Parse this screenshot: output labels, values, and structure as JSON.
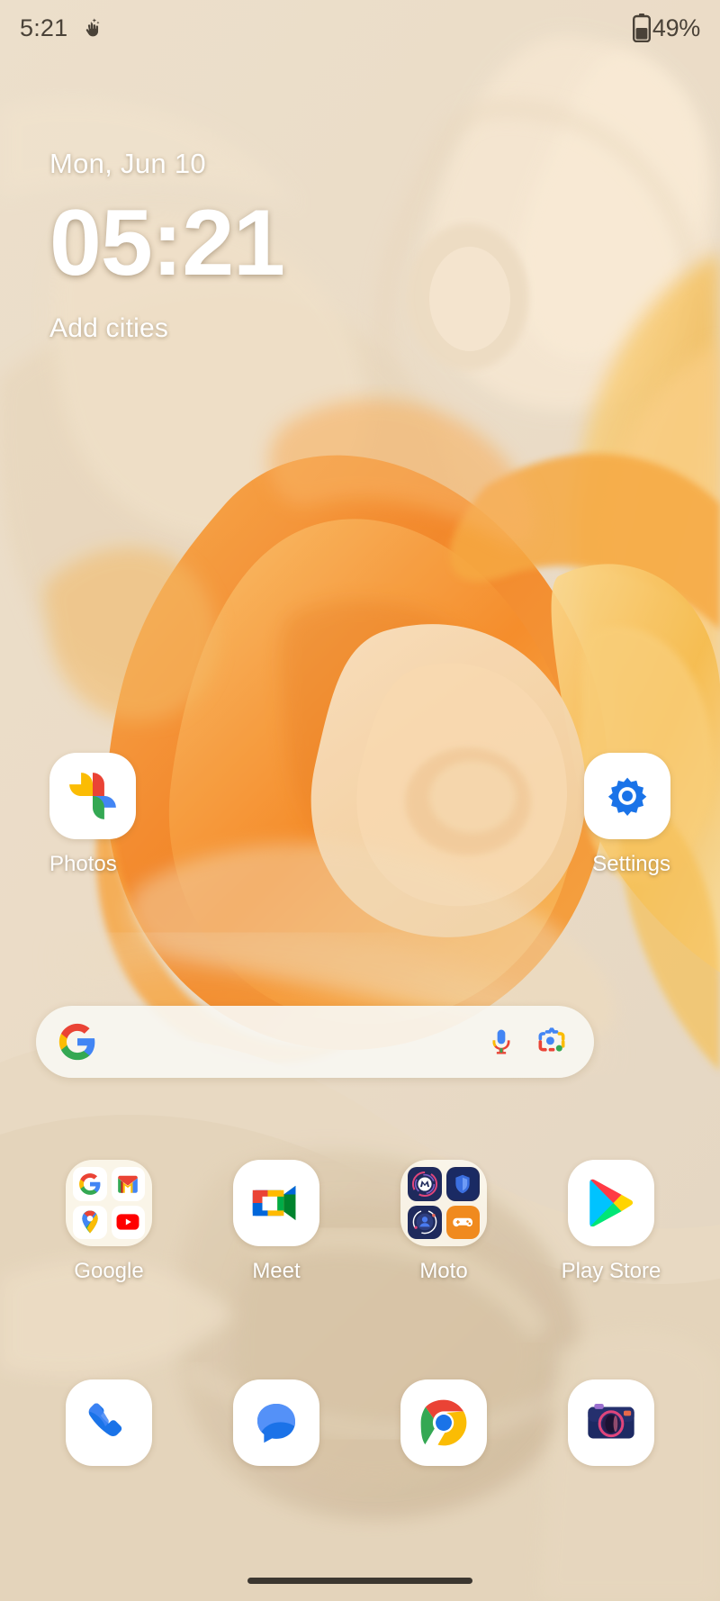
{
  "status_bar": {
    "time": "5:21",
    "left_icon": "sparkle-hand-icon",
    "battery_icon": "battery-icon",
    "battery_percent": "49%"
  },
  "clock_widget": {
    "date": "Mon, Jun 10",
    "time": "05:21",
    "add_cities_label": "Add cities"
  },
  "search": {
    "google_icon": "google-g-icon",
    "mic_icon": "microphone-icon",
    "lens_icon": "google-lens-icon",
    "placeholder": ""
  },
  "app_rows": [
    {
      "row": "row-1",
      "apps": [
        {
          "label": "Photos",
          "icon": "google-photos-icon"
        },
        {
          "label": "Settings",
          "icon": "settings-gear-icon"
        }
      ]
    },
    {
      "row": "row-2",
      "apps": [
        {
          "label": "Google",
          "icon": "google-folder-icon",
          "folder_items": [
            "google-g-icon",
            "gmail-icon",
            "google-maps-icon",
            "youtube-icon"
          ]
        },
        {
          "label": "Meet",
          "icon": "google-meet-icon"
        },
        {
          "label": "Moto",
          "icon": "moto-folder-icon",
          "folder_items": [
            "moto-logo-icon",
            "moto-secure-shield-icon",
            "moto-account-icon",
            "moto-gametime-icon"
          ]
        },
        {
          "label": "Play Store",
          "icon": "google-play-store-icon"
        }
      ]
    }
  ],
  "dock": {
    "apps": [
      {
        "label": "Phone",
        "icon": "phone-icon"
      },
      {
        "label": "Messages",
        "icon": "messages-icon"
      },
      {
        "label": "Chrome",
        "icon": "chrome-icon"
      },
      {
        "label": "Camera",
        "icon": "camera-icon"
      }
    ]
  },
  "nav_bar": {
    "handle": "home-gesture-pill"
  },
  "colors": {
    "wallpaper_base": "#ede0cd",
    "wallpaper_orange": "#f58220",
    "wallpaper_amber": "#f5b942",
    "status_text": "#4a4238",
    "label_text": "#ffffff"
  }
}
